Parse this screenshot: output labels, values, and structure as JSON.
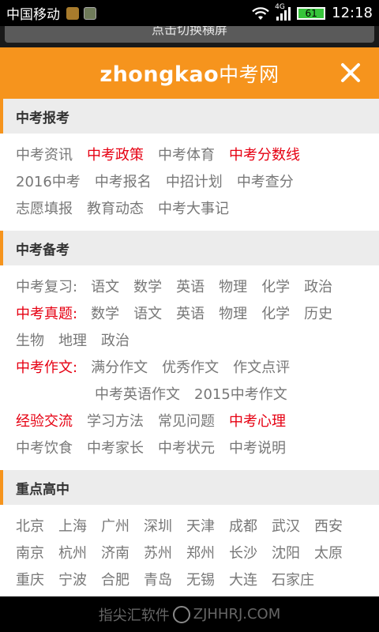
{
  "status": {
    "carrier": "中国移动",
    "network": "4G",
    "battery": "61",
    "time": "12:18"
  },
  "top_button": "点击切换横屏",
  "header": {
    "brand_en": "zhongkao",
    "brand_cn": "中考网"
  },
  "sections": {
    "s1": {
      "title": "中考报考",
      "rows": [
        [
          "中考资讯",
          "中考政策",
          "中考体育",
          "中考分数线"
        ],
        [
          "2016中考",
          "中考报名",
          "中招计划",
          "中考查分"
        ],
        [
          "志愿填报",
          "教育动态",
          "中考大事记"
        ]
      ]
    },
    "s2": {
      "title": "中考备考",
      "fuxi_label": "中考复习:",
      "fuxi": [
        "语文",
        "数学",
        "英语",
        "物理",
        "化学",
        "政治"
      ],
      "zhenti_label": "中考真题:",
      "zhenti": [
        "数学",
        "语文",
        "英语",
        "物理",
        "化学",
        "历史"
      ],
      "zhenti2": [
        "生物",
        "地理",
        "政治"
      ],
      "zuowen_label": "中考作文:",
      "zuowen": [
        "满分作文",
        "优秀作文",
        "作文点评"
      ],
      "zuowen2": [
        "中考英语作文",
        "2015中考作文"
      ],
      "misc1": [
        "经验交流",
        "学习方法",
        "常见问题",
        "中考心理"
      ],
      "misc2": [
        "中考饮食",
        "中考家长",
        "中考状元",
        "中考说明"
      ]
    },
    "s3": {
      "title": "重点高中",
      "cities1": [
        "北京",
        "上海",
        "广州",
        "深圳",
        "天津",
        "成都",
        "武汉",
        "西安"
      ],
      "cities2": [
        "南京",
        "杭州",
        "济南",
        "苏州",
        "郑州",
        "长沙",
        "沈阳",
        "太原"
      ],
      "cities3": [
        "重庆",
        "宁波",
        "合肥",
        "青岛",
        "无锡",
        "大连",
        "石家庄"
      ]
    }
  },
  "watermark": {
    "left": "指尖汇软件",
    "right": "ZJHHRJ.COM"
  },
  "colors": {
    "accent": "#f6941d",
    "highlight": "#e60012"
  }
}
